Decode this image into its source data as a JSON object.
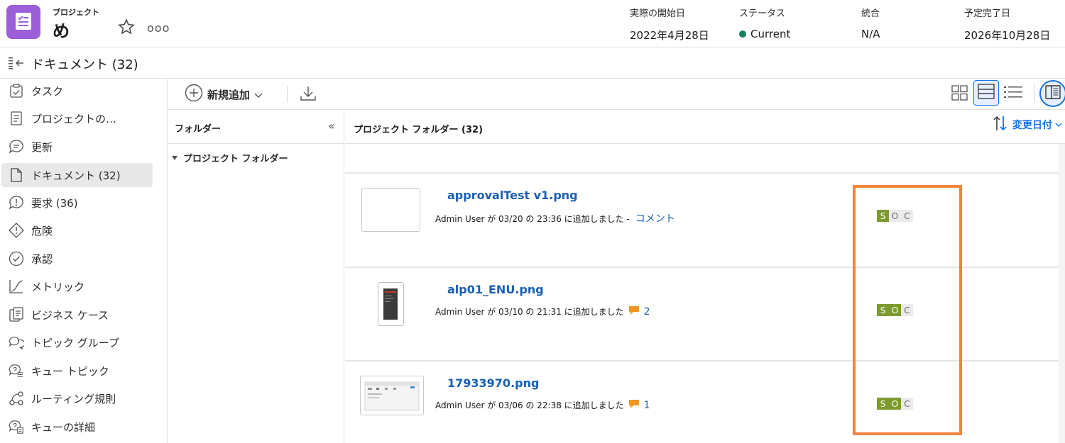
{
  "header": {
    "project_label": "プロジェクト",
    "project_name": "め",
    "more": "ooo",
    "meta": [
      {
        "label": "実際の開始日",
        "value": "2022年4月28日"
      },
      {
        "label": "ステータス",
        "value": "Current",
        "status_color": "#12805c"
      },
      {
        "label": "統合",
        "value": "N/A"
      },
      {
        "label": "予定完了日",
        "value": "2026年10月28日"
      }
    ],
    "icon_color": "#9d5ed9"
  },
  "titlebar": {
    "title": "ドキュメント (32)"
  },
  "sidebar": {
    "items": [
      {
        "label": "タスク",
        "icon": "clipboard-check-icon"
      },
      {
        "label": "プロジェクトの…",
        "icon": "document-lines-icon"
      },
      {
        "label": "更新",
        "icon": "chat-bubble-icon"
      },
      {
        "label": "ドキュメント (32)",
        "icon": "document-icon",
        "active": true
      },
      {
        "label": "要求 (36)",
        "icon": "alert-bubble-icon"
      },
      {
        "label": "危険",
        "icon": "alert-diamond-icon"
      },
      {
        "label": "承認",
        "icon": "checkmark-circle-icon"
      },
      {
        "label": "メトリック",
        "icon": "line-chart-icon"
      },
      {
        "label": "ビジネス ケース",
        "icon": "business-case-icon"
      },
      {
        "label": "トピック グループ",
        "icon": "topic-group-icon"
      },
      {
        "label": "キュー トピック",
        "icon": "queue-topic-icon"
      },
      {
        "label": "ルーティング規則",
        "icon": "routing-icon"
      },
      {
        "label": "キューの詳細",
        "icon": "queue-details-icon"
      }
    ]
  },
  "toolbar": {
    "add_label": "新規追加"
  },
  "folders": {
    "title": "フォルダー",
    "collapse": "«",
    "root": "プロジェクト フォルダー"
  },
  "content": {
    "title": "プロジェクト フォルダー (32)",
    "sort_label": "変更日付",
    "documents": [
      {
        "name": "approvalTest v1.png",
        "info": "Admin User が 03/20 の 23:36 に追加しました -",
        "link": "コメント",
        "comments": null,
        "soc": [
          "S",
          "O",
          "C"
        ],
        "soc_on": [
          true,
          false,
          false
        ]
      },
      {
        "name": "alp01_ENU.png",
        "info": "Admin User が 03/10 の 21:31 に追加しました",
        "link": null,
        "comments": "2",
        "soc": [
          "S",
          "O",
          "C"
        ],
        "soc_on": [
          true,
          true,
          false
        ]
      },
      {
        "name": "17933970.png",
        "info": "Admin User が 03/06 の 22:38 に追加しました",
        "link": null,
        "comments": "1",
        "soc": [
          "S",
          "O",
          "C"
        ],
        "soc_on": [
          true,
          true,
          false
        ]
      }
    ]
  },
  "colors": {
    "accent": "#1473e6",
    "link": "#1a5fb4",
    "soc_on": "#7d9a2e",
    "highlight": "#f08541"
  }
}
